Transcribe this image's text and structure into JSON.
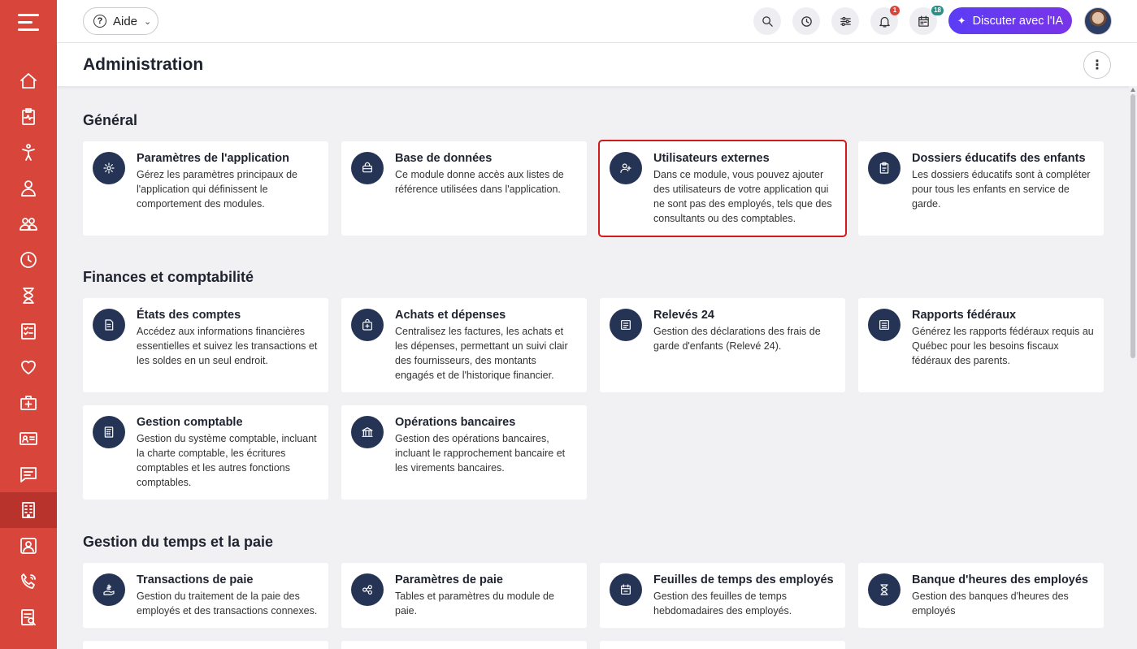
{
  "topbar": {
    "help_label": "Aide",
    "ai_label": "Discuter avec l'IA",
    "notifications_badge": "1",
    "calendar_badge": "18"
  },
  "page": {
    "title": "Administration"
  },
  "sections": {
    "general": {
      "title": "Général",
      "cards": [
        {
          "title": "Paramètres de l'application",
          "desc": "Gérez les paramètres principaux de l'application qui définissent le comportement des modules.",
          "icon": "gear-icon"
        },
        {
          "title": "Base de données",
          "desc": "Ce module donne accès aux listes de référence utilisées dans l'application.",
          "icon": "database-icon"
        },
        {
          "title": "Utilisateurs externes",
          "desc": "Dans ce module, vous pouvez ajouter des utilisateurs de votre application qui ne sont pas des employés, tels que des consultants ou des comptables.",
          "icon": "user-plus-icon"
        },
        {
          "title": "Dossiers éducatifs des enfants",
          "desc": "Les dossiers éducatifs sont à compléter pour tous les enfants en service de garde.",
          "icon": "clipboard-icon"
        }
      ]
    },
    "finances": {
      "title": "Finances et comptabilité",
      "cards": [
        {
          "title": "États des comptes",
          "desc": "Accédez aux informations financières essentielles et suivez les transactions et les soldes en un seul endroit.",
          "icon": "document-icon"
        },
        {
          "title": "Achats et dépenses",
          "desc": "Centralisez les factures, les achats et les dépenses, permettant un suivi clair des fournisseurs, des montants engagés et de l'historique financier.",
          "icon": "shopping-bag-icon"
        },
        {
          "title": "Relevés 24",
          "desc": "Gestion des déclarations des frais de garde d'enfants (Relevé 24).",
          "icon": "receipt-icon"
        },
        {
          "title": "Rapports fédéraux",
          "desc": "Générez les rapports fédéraux requis au Québec pour les besoins fiscaux fédéraux des parents.",
          "icon": "report-icon"
        },
        {
          "title": "Gestion comptable",
          "desc": "Gestion du système comptable, incluant la charte comptable, les écritures comptables et les autres fonctions comptables.",
          "icon": "calculator-icon"
        },
        {
          "title": "Opérations bancaires",
          "desc": "Gestion des opérations bancaires, incluant le rapprochement bancaire et les virements bancaires.",
          "icon": "bank-icon"
        }
      ]
    },
    "payroll": {
      "title": "Gestion du temps et la paie",
      "cards": [
        {
          "title": "Transactions de paie",
          "desc": "Gestion du traitement de la paie des employés et des transactions connexes.",
          "icon": "payment-icon"
        },
        {
          "title": "Paramètres de paie",
          "desc": "Tables et paramètres du module de paie.",
          "icon": "settings-nodes-icon"
        },
        {
          "title": "Feuilles de temps des employés",
          "desc": "Gestion des feuilles de temps hebdomadaires des employés.",
          "icon": "calendar-icon"
        },
        {
          "title": "Banque d'heures des employés",
          "desc": "Gestion des banques d'heures des employés",
          "icon": "hourglass-icon"
        }
      ]
    }
  },
  "sidebar": {
    "items": [
      "home-icon",
      "clipboard-pulse-icon",
      "child-icon",
      "person-icon",
      "group-icon",
      "clock-icon",
      "hourglass-icon",
      "checklist-icon",
      "heart-icon",
      "medical-kit-icon",
      "id-card-icon",
      "chat-icon",
      "building-icon",
      "contact-icon",
      "phone-icon",
      "report-search-icon"
    ],
    "active": "building-icon"
  }
}
